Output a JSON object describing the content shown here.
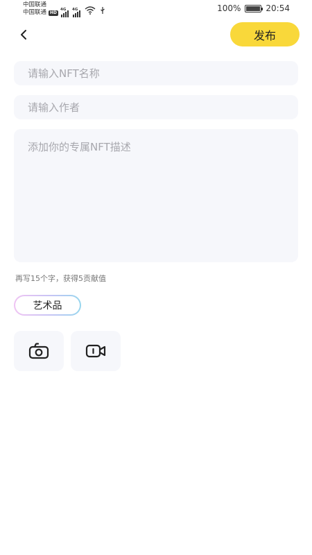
{
  "status_bar": {
    "carrier_1": "中国联通",
    "carrier_2": "中国联通",
    "hd_badge": "HD",
    "network_1": "4G",
    "network_2": "4G",
    "battery_percent": "100%",
    "battery_level": 1.0,
    "time": "20:54"
  },
  "header": {
    "back_icon": "chevron-left",
    "publish_label": "发布"
  },
  "form": {
    "name_placeholder": "请输入NFT名称",
    "name_value": "",
    "author_placeholder": "请输入作者",
    "author_value": "",
    "description_placeholder": "添加你的专属NFT描述",
    "description_value": "",
    "hint": "再写15个字，获得5贡献值"
  },
  "tag": {
    "label": "艺术品"
  },
  "media": {
    "camera_icon": "camera-icon",
    "video_icon": "video-camera-icon"
  },
  "colors": {
    "accent": "#f9d83a",
    "field_bg": "#f6f7fb",
    "placeholder": "#a7a7ad"
  }
}
